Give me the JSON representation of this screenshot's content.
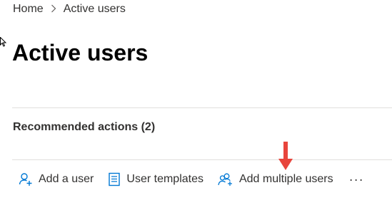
{
  "breadcrumb": {
    "home": "Home",
    "separator": ">",
    "current": "Active users"
  },
  "page_title": "Active users",
  "recommended": {
    "title": "Recommended actions (2)"
  },
  "toolbar": {
    "add_user": "Add a user",
    "user_templates": "User templates",
    "add_multiple": "Add multiple users",
    "more": "···"
  },
  "colors": {
    "accent": "#0078d4",
    "arrow": "#e8453c",
    "text": "#323130",
    "divider": "#e1dfdd"
  },
  "icons": {
    "add_user": "person-add-icon",
    "templates": "document-list-icon",
    "add_multiple": "people-add-icon",
    "annotation": "red-down-arrow-icon",
    "cursor": "mouse-pointer-icon"
  }
}
